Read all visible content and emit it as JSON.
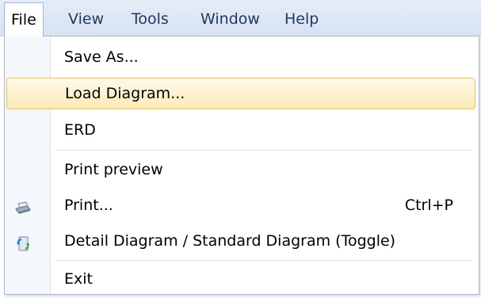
{
  "menubar": {
    "items": [
      {
        "label": "File",
        "active": true
      },
      {
        "label": "View"
      },
      {
        "label": "Tools"
      },
      {
        "label": "Window"
      },
      {
        "label": "Help"
      }
    ]
  },
  "file_menu": {
    "items": [
      {
        "label": "Save As...",
        "shortcut": ""
      },
      {
        "label": "Load Diagram...",
        "shortcut": "",
        "highlighted": true
      },
      {
        "label": "ERD",
        "shortcut": ""
      },
      {
        "label": "Print preview",
        "shortcut": ""
      },
      {
        "label": "Print...",
        "shortcut": "Ctrl+P",
        "icon": "printer-icon"
      },
      {
        "label": "Detail Diagram / Standard Diagram (Toggle)",
        "shortcut": "",
        "icon": "toggle-diagram-icon"
      },
      {
        "label": "Exit",
        "shortcut": ""
      }
    ]
  },
  "colors": {
    "menubar_bg": "#dbe5f3",
    "menubar_text": "#1e395b",
    "highlight_bg": "#fdeab8",
    "highlight_border": "#e5c365",
    "gutter_bg": "#f4f7fb",
    "separator": "#e2e3e3"
  }
}
